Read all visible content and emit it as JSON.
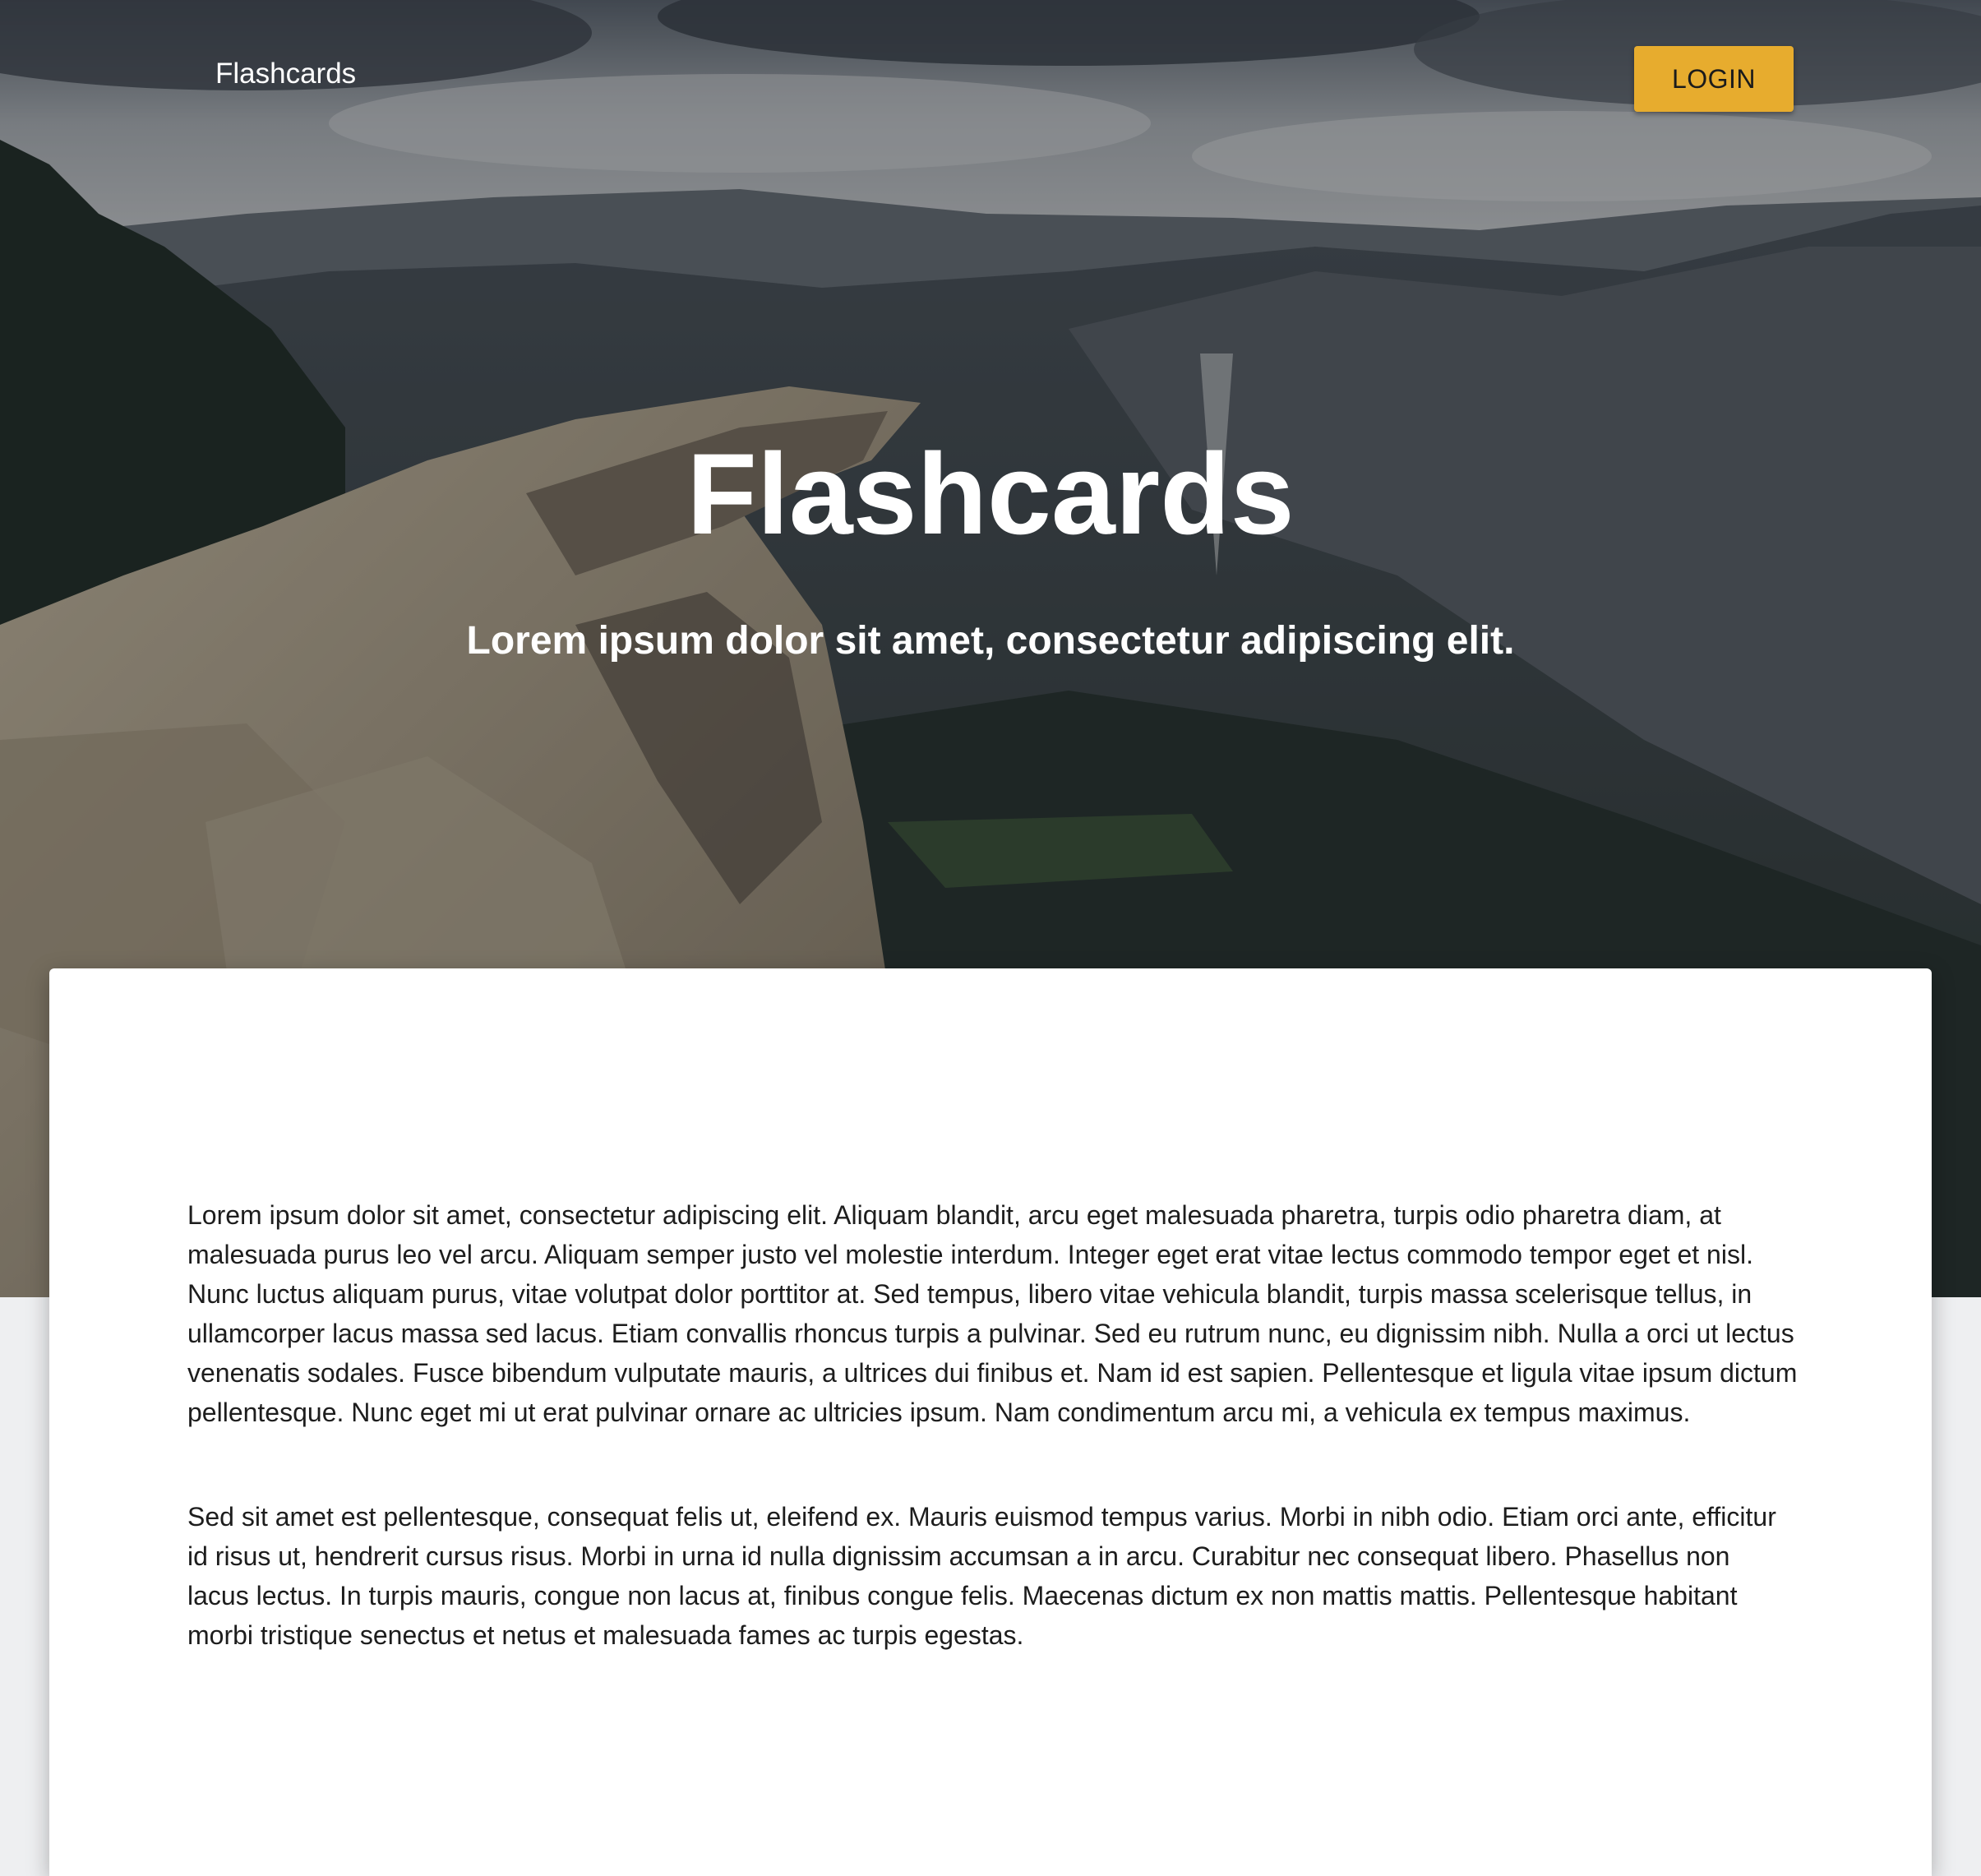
{
  "navbar": {
    "brand": "Flashcards",
    "login_label": "LOGIN"
  },
  "hero": {
    "title": "Flashcards",
    "subtitle": "Lorem ipsum dolor sit amet, consectetur adipiscing elit.",
    "background": "mountain valley landscape photo"
  },
  "content": {
    "paragraphs": [
      "Lorem ipsum dolor sit amet, consectetur adipiscing elit. Aliquam blandit, arcu eget malesuada pharetra, turpis odio pharetra diam, at malesuada purus leo vel arcu. Aliquam semper justo vel molestie interdum. Integer eget erat vitae lectus commodo tempor eget et nisl. Nunc luctus aliquam purus, vitae volutpat dolor porttitor at. Sed tempus, libero vitae vehicula blandit, turpis massa scelerisque tellus, in ullamcorper lacus massa sed lacus. Etiam convallis rhoncus turpis a pulvinar. Sed eu rutrum nunc, eu dignissim nibh. Nulla a orci ut lectus venenatis sodales. Fusce bibendum vulputate mauris, a ultrices dui finibus et. Nam id est sapien. Pellentesque et ligula vitae ipsum dictum pellentesque. Nunc eget mi ut erat pulvinar ornare ac ultricies ipsum. Nam condimentum arcu mi, a vehicula ex tempus maximus.",
      "Sed sit amet est pellentesque, consequat felis ut, eleifend ex. Mauris euismod tempus varius. Morbi in nibh odio. Etiam orci ante, efficitur id risus ut, hendrerit cursus risus. Morbi in urna id nulla dignissim accumsan a in arcu. Curabitur nec consequat libero. Phasellus non lacus lectus. In turpis mauris, congue non lacus at, finibus congue felis. Maecenas dictum ex non mattis mattis. Pellentesque habitant morbi tristique senectus et netus et malesuada fames ac turpis egestas."
    ]
  },
  "colors": {
    "accent": "#e7ac2e",
    "page_background": "#eeeff1",
    "card_background": "#ffffff",
    "text": "#1d1d1d"
  }
}
